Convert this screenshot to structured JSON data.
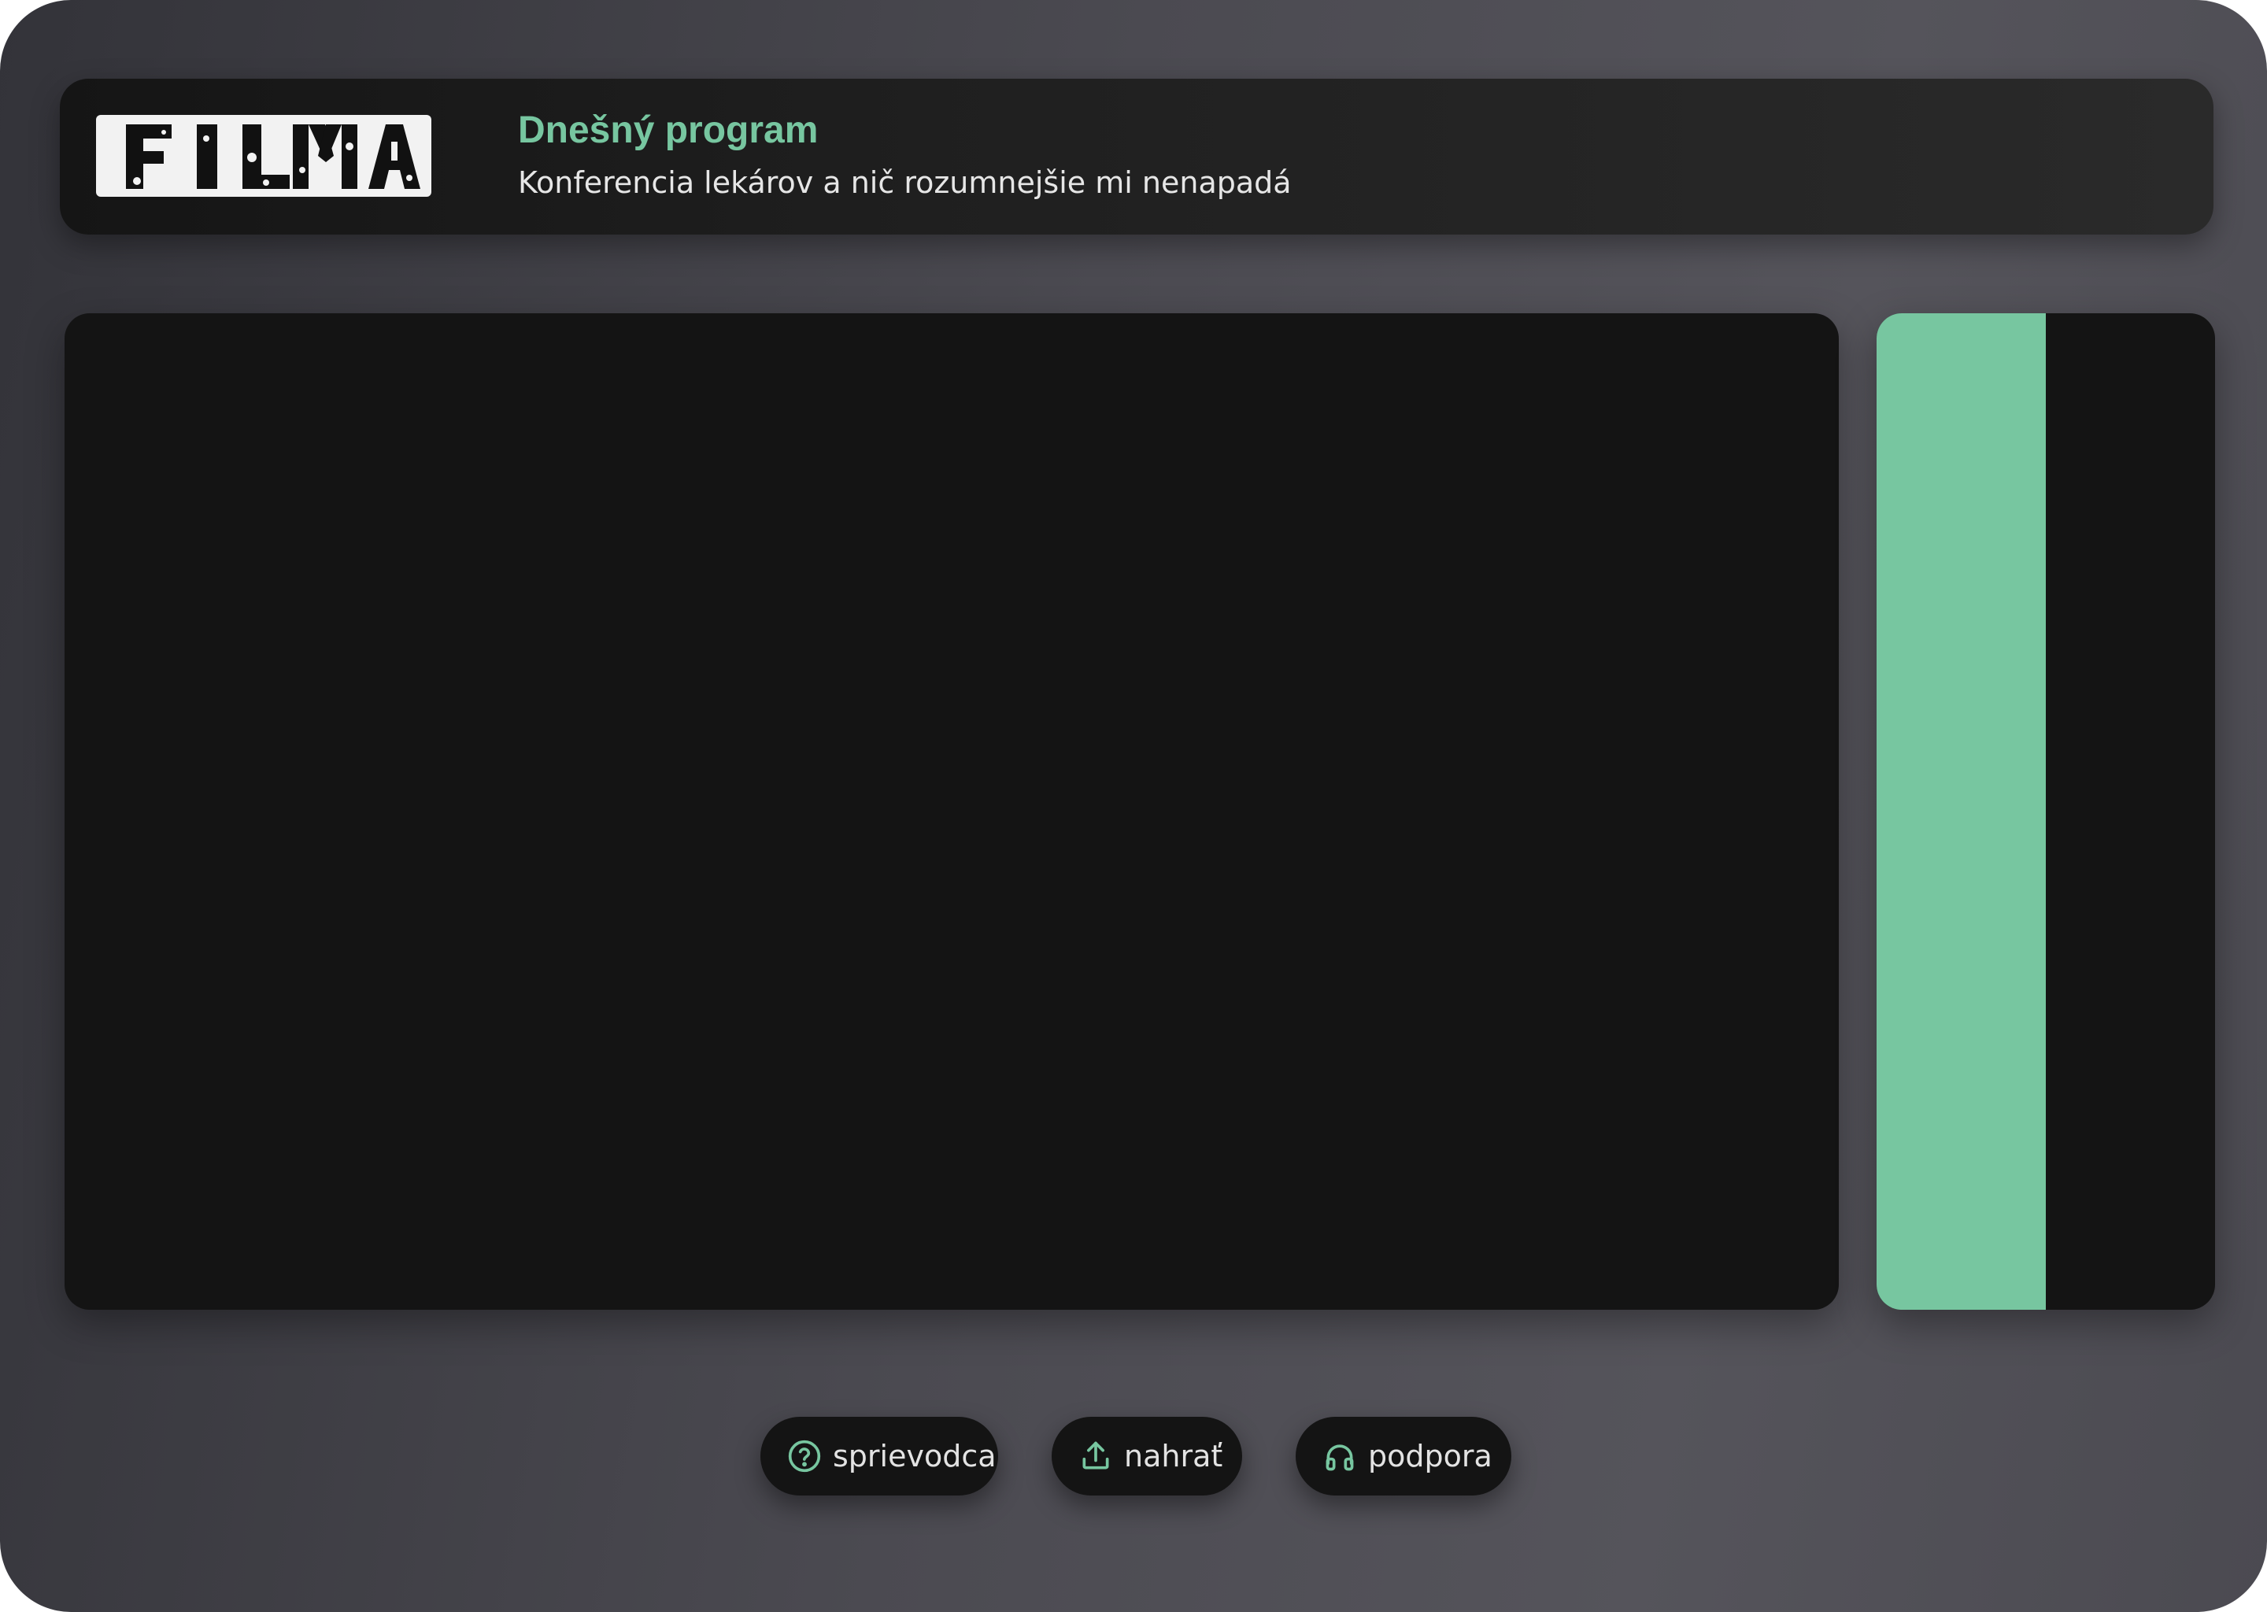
{
  "header": {
    "logo_text": "FILMA",
    "program_title": "Dnešný program",
    "program_subtitle": "Konferencia lekárov a nič rozumnejšie mi nenapadá"
  },
  "side_panel": {
    "fill_fraction": 0.5
  },
  "actions": [
    {
      "label": "sprievodca",
      "icon": "question-circle-icon"
    },
    {
      "label": "nahrať",
      "icon": "upload-icon"
    },
    {
      "label": "podpora",
      "icon": "headphones-icon"
    }
  ],
  "colors": {
    "accent": "#77c6a0",
    "panel": "#141414",
    "header_start": "#151515",
    "header_end": "#2a2a2a",
    "background": "#4b4a51",
    "text": "#e6e6e6"
  }
}
